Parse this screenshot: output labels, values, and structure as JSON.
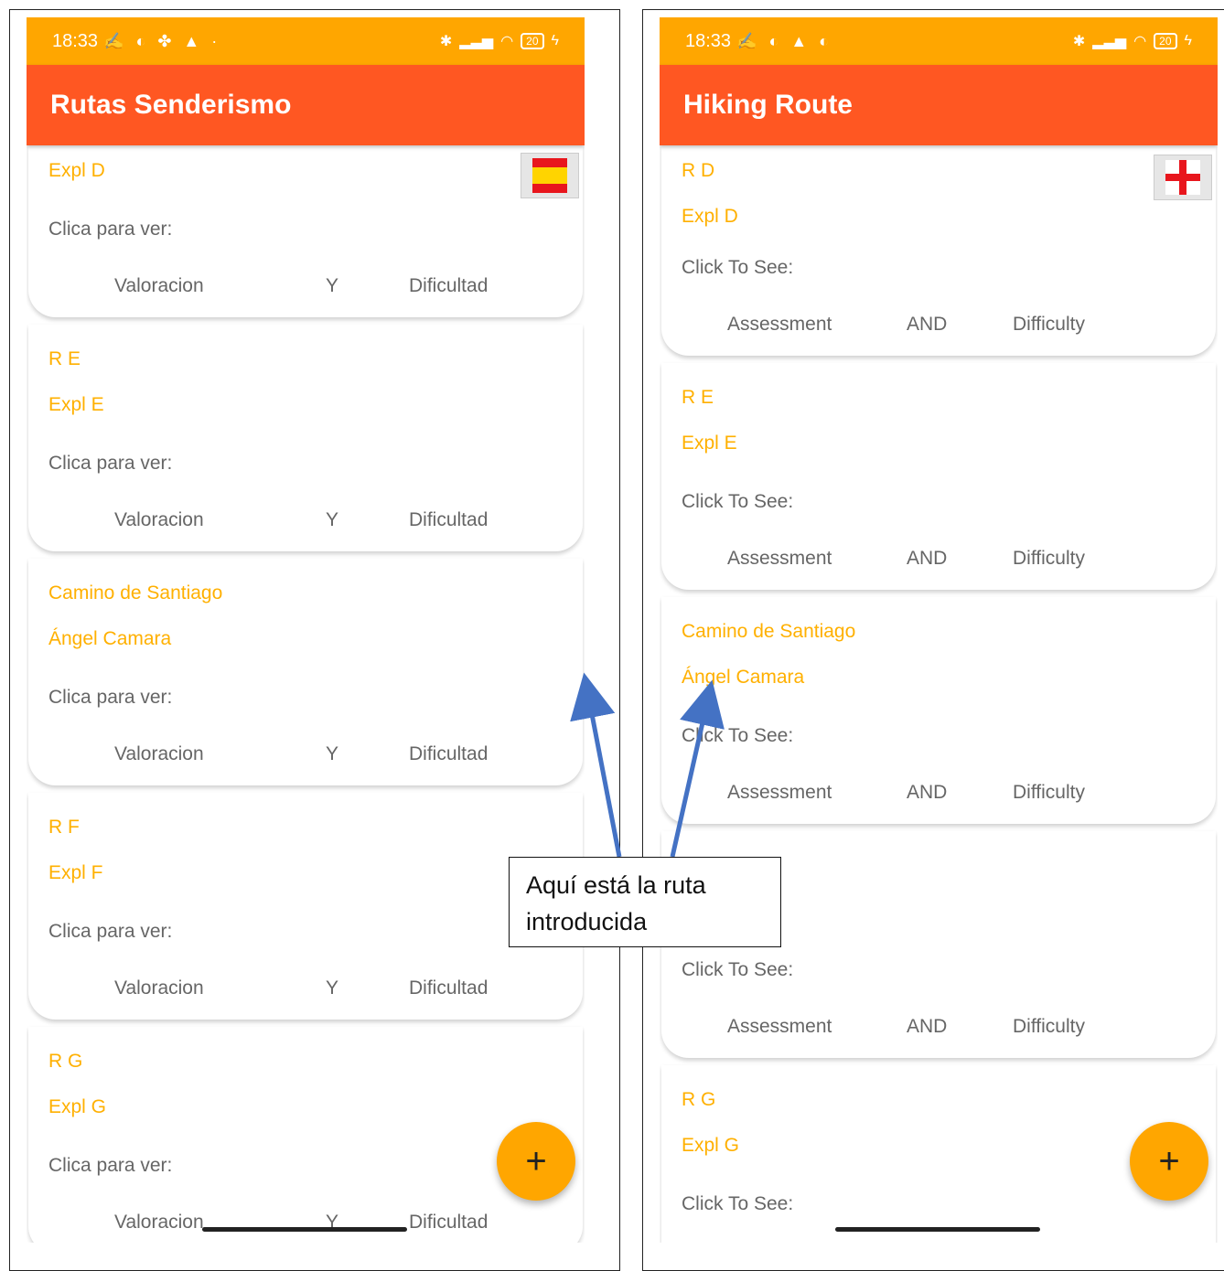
{
  "left": {
    "status": {
      "time": "18:33",
      "battery": "20"
    },
    "title": "Rutas Senderismo",
    "flag_icon": "spain-flag-icon",
    "cards": [
      {
        "lines": [
          "Expl D"
        ],
        "hint": "Clica para ver:",
        "col1": "Valoracion",
        "col2": "Y",
        "col3": "Dificultad"
      },
      {
        "lines": [
          "R E",
          "Expl E"
        ],
        "hint": "Clica para ver:",
        "col1": "Valoracion",
        "col2": "Y",
        "col3": "Dificultad"
      },
      {
        "lines": [
          "Camino de Santiago",
          "Ángel Camara"
        ],
        "hint": "Clica para ver:",
        "col1": "Valoracion",
        "col2": "Y",
        "col3": "Dificultad"
      },
      {
        "lines": [
          "R F",
          "Expl F"
        ],
        "hint": "Clica para ver:",
        "col1": "Valoracion",
        "col2": "Y",
        "col3": "Dificultad"
      },
      {
        "lines": [
          "R G",
          "Expl G"
        ],
        "hint": "Clica para ver:",
        "col1": "Valoracion",
        "col2": "Y",
        "col3": "Dificultad"
      }
    ],
    "fab": "+"
  },
  "right": {
    "status": {
      "time": "18:33",
      "battery": "20"
    },
    "title": "Hiking Route",
    "flag_icon": "england-flag-icon",
    "cards": [
      {
        "lines": [
          "R D",
          "Expl D"
        ],
        "hint": "Click To See:",
        "col1": "Assessment",
        "col2": "AND",
        "col3": "Difficulty"
      },
      {
        "lines": [
          "R E",
          "Expl E"
        ],
        "hint": "Click To See:",
        "col1": "Assessment",
        "col2": "AND",
        "col3": "Difficulty"
      },
      {
        "lines": [
          "Camino de Santiago",
          "Ángel Camara"
        ],
        "hint": "Click To See:",
        "col1": "Assessment",
        "col2": "AND",
        "col3": "Difficulty"
      },
      {
        "lines": [],
        "hint": "Click To See:",
        "col1": "Assessment",
        "col2": "AND",
        "col3": "Difficulty"
      },
      {
        "lines": [
          "R G",
          "Expl G"
        ],
        "hint": "Click To See:",
        "col1": "",
        "col2": "",
        "col3": ""
      }
    ],
    "fab": "+"
  },
  "callout": {
    "line1": "Aquí está la ruta",
    "line2": "introducida"
  },
  "colors": {
    "status_bar": "#ffa600",
    "app_bar": "#ff5722",
    "accent_text": "#ffb000",
    "arrow": "#4472c4"
  }
}
